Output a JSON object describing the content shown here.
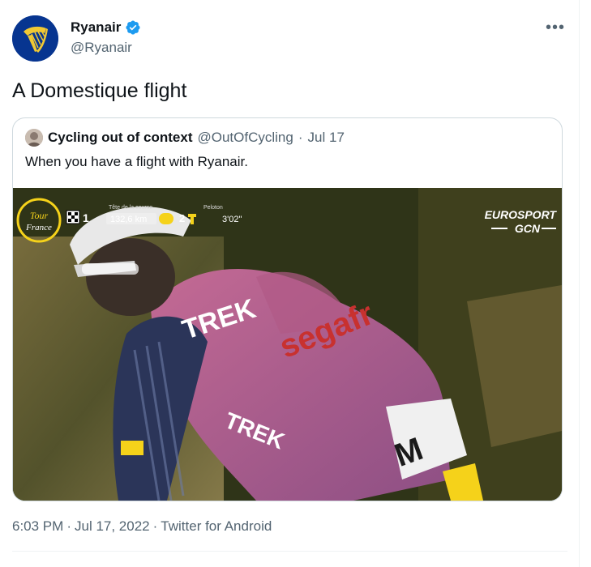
{
  "tweet": {
    "display_name": "Ryanair",
    "handle": "@Ryanair",
    "text": "A Domestique flight",
    "more_icon": "more-dots-icon",
    "verified_icon": "verified-badge-icon",
    "brand_color": "#073590",
    "verified_color": "#1d9bf0"
  },
  "quote": {
    "display_name": "Cycling out of context",
    "handle": "@OutOfCycling",
    "separator": "·",
    "date": "Jul 17",
    "text": "When you have a flight with Ryanair."
  },
  "media": {
    "overlay": {
      "logo_line1": "Tour",
      "logo_line2": "France",
      "position": "1",
      "tete_label": "Tête de la course",
      "distance": "132,6 km",
      "riders": "2",
      "peloton_label": "Peloton",
      "gap": "3'02\""
    },
    "broadcaster_1": "EUROSPORT",
    "broadcaster_2": "GCN"
  },
  "footer": {
    "time": "6:03 PM",
    "sep1": "·",
    "date": "Jul 17, 2022",
    "sep2": "·",
    "source": "Twitter for Android"
  }
}
